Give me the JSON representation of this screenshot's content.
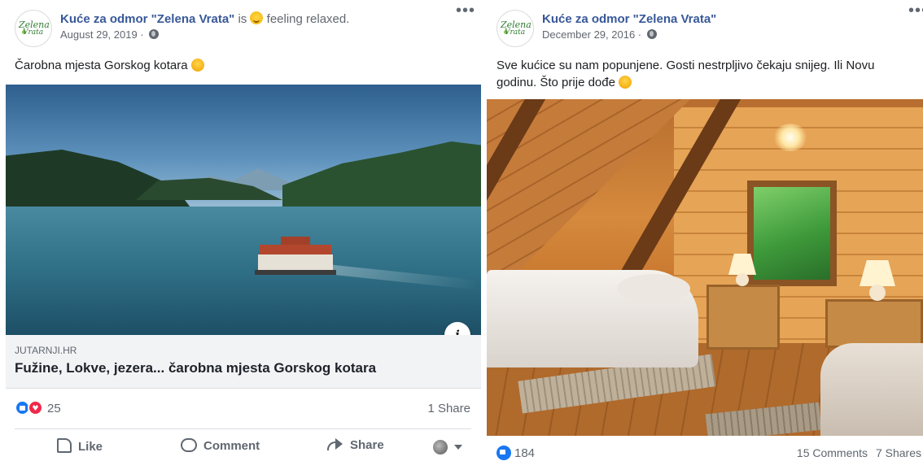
{
  "post1": {
    "page_name": "Kuće za odmor \"Zelena Vrata\"",
    "status_is": "is",
    "feeling": "feeling relaxed.",
    "date": "August 29, 2019 ·",
    "text": "Čarobna mjesta Gorskog kotara",
    "link": {
      "domain": "JUTARNJI.HR",
      "title": "Fužine, Lokve, jezera... čarobna mjesta Gorskog kotara"
    },
    "reaction_count": "25",
    "shares": "1 Share",
    "actions": {
      "like": "Like",
      "comment": "Comment",
      "share": "Share"
    }
  },
  "post2": {
    "page_name": "Kuće za odmor \"Zelena Vrata\"",
    "date": "December 29, 2016 ·",
    "text_line1": "Sve kućice su nam popunjene. Gosti nestrpljivo čekaju snijeg. Ili Novu",
    "text_line2": "godinu. Što prije dođe",
    "reaction_count": "184",
    "comments": "15 Comments",
    "shares": "7 Shares"
  },
  "avatar": {
    "logo_line1": "Zelena",
    "logo_line2": "Vrata"
  },
  "more_glyph": "•••",
  "info_glyph": "i",
  "colors": {
    "page_name": "#385898",
    "like_blue": "#1877f2",
    "love_red": "#f0284a",
    "secondary_text": "#606770"
  }
}
